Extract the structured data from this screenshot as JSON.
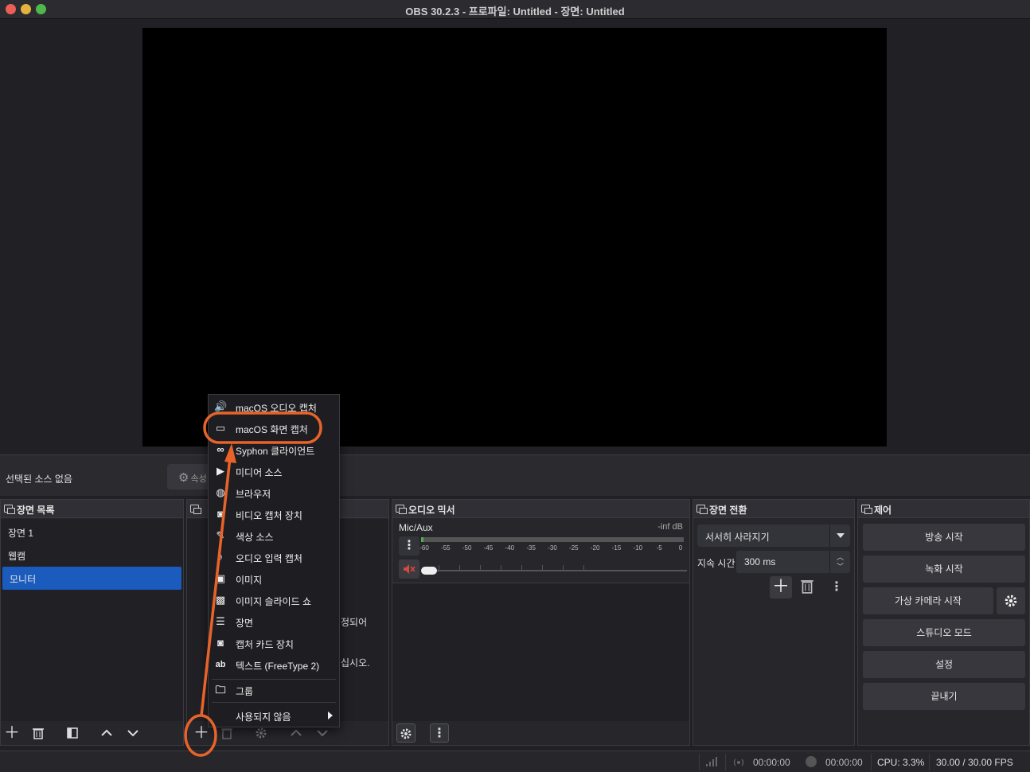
{
  "window": {
    "title": "OBS 30.2.3 - 프로파일: Untitled - 장면: Untitled"
  },
  "context_bar": {
    "no_source_label": "선택된 소스 없음",
    "properties_label": "속성"
  },
  "scenes": {
    "title": "장면 목록",
    "items": [
      {
        "label": "장면 1"
      },
      {
        "label": "웹캠"
      },
      {
        "label": "모니터"
      }
    ]
  },
  "sources": {
    "hidden_text_1": "정되어",
    "hidden_text_2": "십시오."
  },
  "mixer": {
    "title": "오디오 믹서",
    "channel": "Mic/Aux",
    "level": "-inf dB",
    "ticks": [
      "-60",
      "-55",
      "-50",
      "-45",
      "-40",
      "-35",
      "-30",
      "-25",
      "-20",
      "-15",
      "-10",
      "-5",
      "0"
    ]
  },
  "transitions": {
    "title": "장면 전환",
    "selected": "서서히 사라지기",
    "duration_label": "지속 시간",
    "duration_value": "300 ms"
  },
  "controls": {
    "title": "제어",
    "start_streaming": "방송 시작",
    "start_recording": "녹화 시작",
    "start_virtual_camera": "가상 카메라 시작",
    "studio_mode": "스튜디오 모드",
    "settings": "설정",
    "exit": "끝내기"
  },
  "status": {
    "stream_time": "00:00:00",
    "record_time": "00:00:00",
    "cpu": "CPU: 3.3%",
    "fps": "30.00 / 30.00 FPS"
  },
  "add_source_menu": {
    "items": [
      {
        "label": "macOS 오디오 캡처",
        "icon": "speaker-icon"
      },
      {
        "label": "macOS 화면 캡처",
        "icon": "monitor-icon"
      },
      {
        "label": "Syphon 클라이언트",
        "icon": "gamepad-icon"
      },
      {
        "label": "미디어 소스",
        "icon": "play-icon"
      },
      {
        "label": "브라우저",
        "icon": "globe-icon"
      },
      {
        "label": "비디오 캡처 장치",
        "icon": "camera-icon"
      },
      {
        "label": "색상 소스",
        "icon": "brush-icon"
      },
      {
        "label": "오디오 입력 캡처",
        "icon": "microphone-icon"
      },
      {
        "label": "이미지",
        "icon": "image-icon"
      },
      {
        "label": "이미지 슬라이드 쇼",
        "icon": "slideshow-icon"
      },
      {
        "label": "장면",
        "icon": "list-icon"
      },
      {
        "label": "캡처 카드 장치",
        "icon": "camera-icon"
      },
      {
        "label": "텍스트 (FreeType 2)",
        "icon": "text-icon"
      }
    ],
    "group_label": "그룹",
    "deprecated_label": "사용되지 않음"
  },
  "annotation": {
    "color": "#e8632a"
  }
}
